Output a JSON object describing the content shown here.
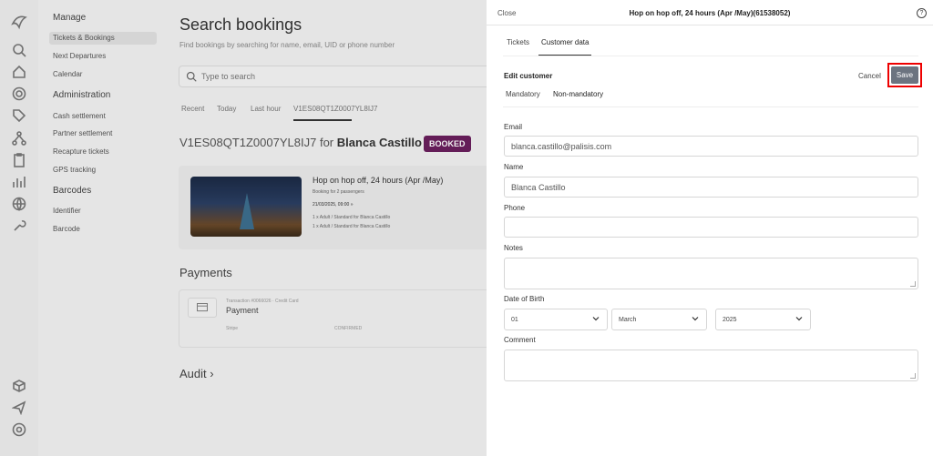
{
  "sidebar": {
    "sections": [
      {
        "title": "Manage",
        "items": [
          "Tickets & Bookings",
          "Next Departures",
          "Calendar"
        ]
      },
      {
        "title": "Administration",
        "items": [
          "Cash settlement",
          "Partner settlement",
          "Recapture tickets",
          "GPS tracking"
        ]
      },
      {
        "title": "Barcodes",
        "items": [
          "Identifier",
          "Barcode"
        ]
      }
    ]
  },
  "rail_icons": [
    "logo-icon",
    "search-icon",
    "home-icon",
    "settings-icon",
    "tag-icon",
    "network-icon",
    "clipboard-icon",
    "chart-icon",
    "globe-icon",
    "wrench-icon",
    "box-icon",
    "send-icon",
    "help-circle-icon"
  ],
  "main": {
    "title": "Search bookings",
    "subtitle": "Find bookings by searching for name, email, UID or phone number",
    "search_placeholder": "Type to search",
    "tabs": [
      "Recent",
      "Today",
      "Last hour",
      "V1ES08QT1Z0007YL8IJ7"
    ],
    "booking_id": "V1ES08QT1Z0007YL8IJ7",
    "booking_for": "for",
    "customer_name": "Blanca Castillo",
    "status": "BOOKED",
    "product_title": "Hop on hop off,  24 hours (Apr /May)",
    "booking_for_text": "Booking for 2 passengers",
    "datetime": "21/03/2025, 09:00 »",
    "line1": "1 x Adult / Standard for Blanca Castillo",
    "line2": "1 x Adult / Standard for Blanca Castillo",
    "payments_title": "Payments",
    "txn": "Transaction #0066026 · Credit Card",
    "payment_label": "Payment",
    "payment_status_left": "Stripe",
    "payment_status_right": "CONFIRMED",
    "audit_title": "Audit"
  },
  "panel": {
    "close": "Close",
    "title": "Hop on hop off,  24 hours (Apr /May)(61538052)",
    "tabs": [
      "Tickets",
      "Customer data"
    ],
    "edit_title": "Edit customer",
    "cancel": "Cancel",
    "save": "Save",
    "subtabs": [
      "Mandatory",
      "Non-mandatory"
    ],
    "fields": {
      "email_label": "Email",
      "email_value": "blanca.castillo@palisis.com",
      "name_label": "Name",
      "name_value": "Blanca Castillo",
      "phone_label": "Phone",
      "phone_value": "",
      "notes_label": "Notes",
      "notes_value": "",
      "dob_label": "Date of Birth",
      "dob_day": "01",
      "dob_month": "March",
      "dob_year": "2025",
      "comment_label": "Comment",
      "comment_value": ""
    }
  }
}
